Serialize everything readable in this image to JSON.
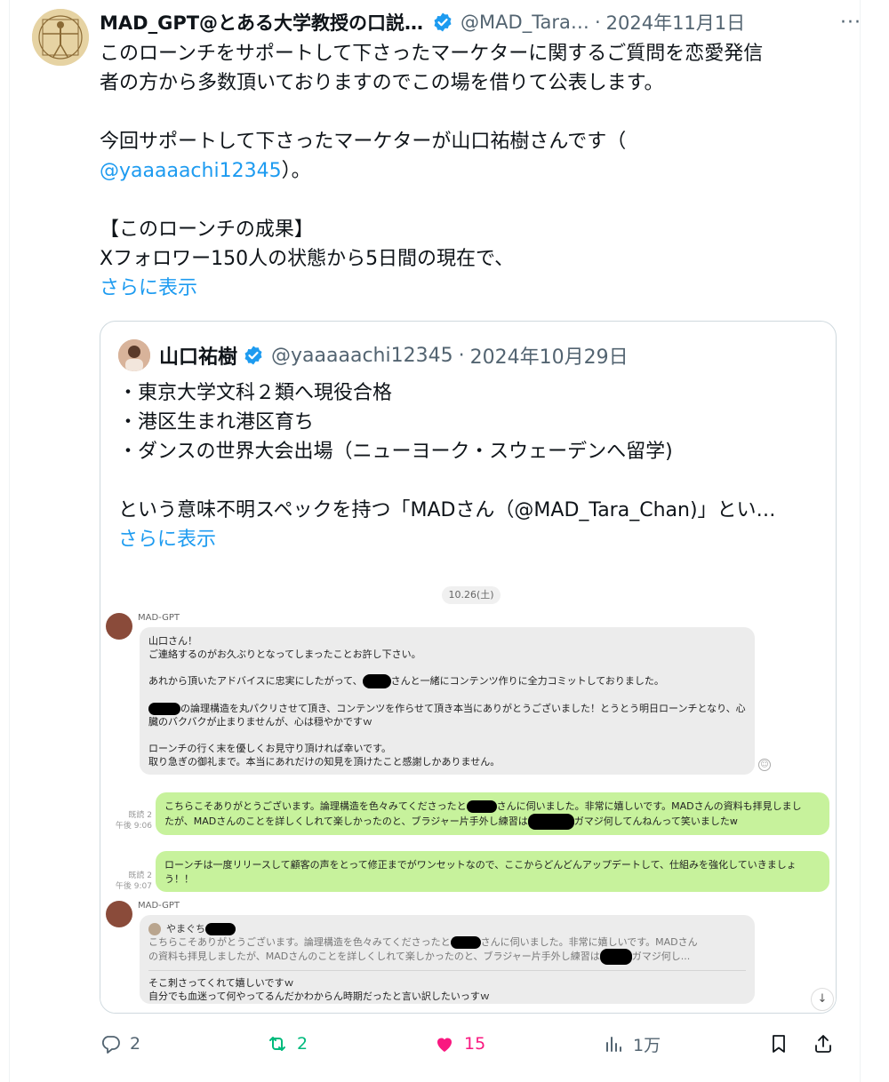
{
  "tweet": {
    "author_name": "MAD_GPT@とある大学教授の口説…",
    "author_handle": "@MAD_Tara…",
    "separator": "·",
    "date": "2024年11月1日",
    "more_label": "···",
    "body_lines": [
      "このローンチをサポートして下さったマーケターに関するご質問を恋愛発信",
      "者の方から多数頂いておりますのでこの場を借りて公表します。",
      "",
      "今回サポートして下さったマーケターが山口祐樹さんです（",
      "",
      "",
      "【このローンチの成果】",
      "Xフォロワー150人の状態から5日間の現在で、"
    ],
    "mention": "@yaaaaachi12345",
    "mention_suffix": "）。",
    "show_more": "さらに表示"
  },
  "quote": {
    "author_name": "山口祐樹",
    "author_handle": "@yaaaaachi12345",
    "separator": "·",
    "date": "2024年10月29日",
    "body_lines": [
      "・東京大学文科２類へ現役合格",
      "・港区生まれ港区育ち",
      "・ダンスの世界大会出場（ニューヨーク・スウェーデンへ留学)",
      "",
      "という意味不明スペックを持つ「MADさん（@MAD_Tara_Chan)」とい…"
    ],
    "show_more": "さらに表示"
  },
  "chat": {
    "date_pill": "10.26(土)",
    "sender_1": "MAD-GPT",
    "msg_1_lines": [
      "山口さん！",
      "ご連絡するのがお久ぶりとなってしまったことお許し下さい。",
      "",
      "あれから頂いたアドバイスに忠実にしたがって、",
      "さんと一緒にコンテンツ作りに全力コミットしておりました。",
      "",
      "の論理構造を丸パクリさせて頂き、コンテンツを作らせて頂き本当にありがとうございました！とうとう明日ローンチとなり、心",
      "臓のバクバクが止まりませんが、心は穏やかですｗ",
      "",
      "ローンチの行く末を優しくお見守り頂ければ幸いです。",
      "取り急ぎの御礼まで。本当にあれだけの知見を頂けたこと感謝しかありません。"
    ],
    "reply_1_meta": [
      "既読 2",
      "午後 9:06"
    ],
    "reply_1_lines": [
      "こちらこそありがとうございます。論理構造を色々みてくださったと",
      "さんに伺いました。非常に嬉しいです。MADさんの資料も拝見しまし",
      "たが、MADさんのことを詳しくしれて楽しかったのと、ブラジャー片手外し練習は",
      "ガマジ何してんねんって笑いましたw"
    ],
    "reply_2_meta": [
      "既読 2",
      "午後 9:07"
    ],
    "reply_2_lines": [
      "ローンチは一度リリースして顧客の声をとって修正までがワンセットなので、ここからどんどんアップデートして、仕組みを強化していきましょ",
      "う！！"
    ],
    "sender_2": "MAD-GPT",
    "quoted_name": "やまぐち",
    "quoted_lines": [
      "こちらこそありがとうございます。論理構造を色々みてくださったと",
      "さんに伺いました。非常に嬉しいです。MADさん",
      "の資料も拝見しましたが、MADさんのことを詳しくしれて楽しかったのと、ブラジャー片手外し練習は",
      "ガマジ何し..."
    ],
    "msg_3_lines": [
      "そこ刺さってくれて嬉しいですｗ",
      "自分でも血迷って何やってるんだかわからん時期だったと言い訳したいっすｗ"
    ]
  },
  "actions": {
    "replies": "2",
    "reposts": "2",
    "likes": "15",
    "views": "1万"
  },
  "colors": {
    "link": "#1d9bf0",
    "repost": "#00ba7c",
    "like": "#f91880",
    "muted": "#536471",
    "bubble_out": "#c7f29c"
  }
}
